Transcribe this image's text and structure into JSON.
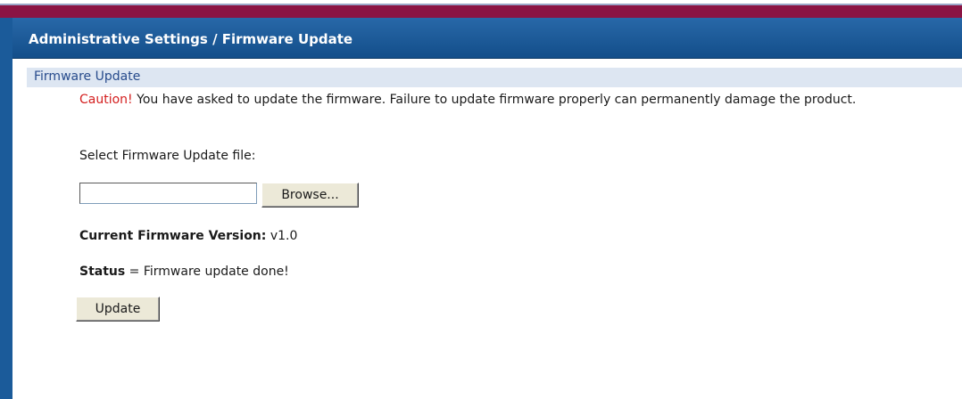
{
  "header": {
    "title": "Administrative Settings / Firmware Update"
  },
  "section": {
    "title": "Firmware Update"
  },
  "caution": {
    "label": "Caution!",
    "message": " You have asked to update the firmware. Failure to update firmware properly can permanently damage the product."
  },
  "file_select": {
    "label": "Select Firmware Update file:",
    "value": "",
    "browse_label": "Browse..."
  },
  "firmware": {
    "label": "Current Firmware Version:",
    "value": " v1.0"
  },
  "status": {
    "label": "Status",
    "value": " = Firmware update done!"
  },
  "actions": {
    "update_label": "Update"
  },
  "colors": {
    "frame_blue": "#1b5b9a",
    "maroon_bar": "#8b1444",
    "section_header_bg": "#dde6f2",
    "section_header_text": "#274b8c",
    "caution_red": "#d42020"
  }
}
